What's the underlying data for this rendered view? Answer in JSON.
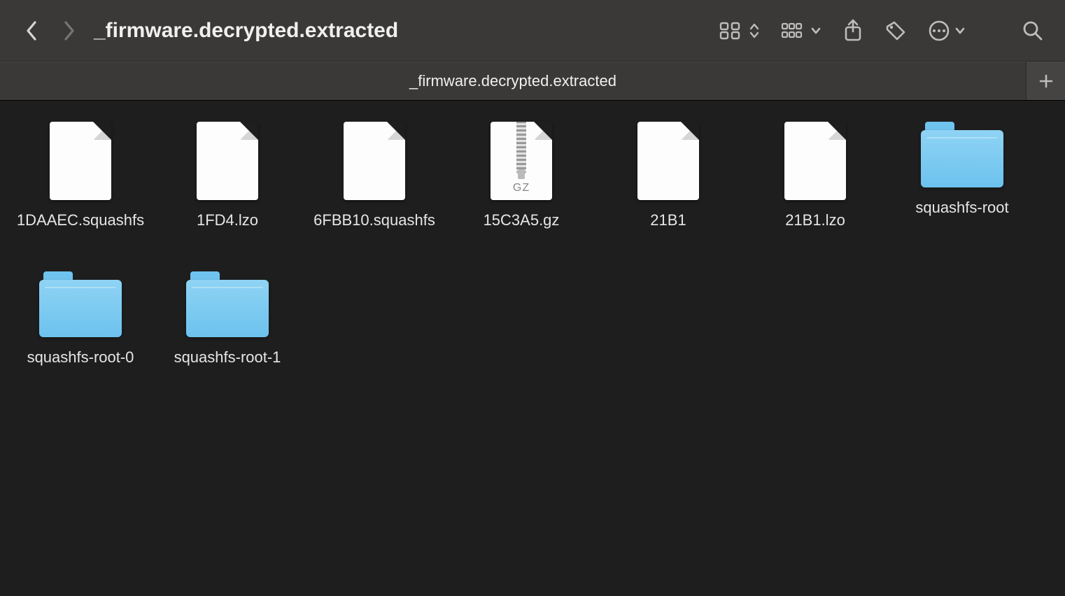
{
  "window": {
    "title": "_firmware.decrypted.extracted",
    "tab_title": "_firmware.decrypted.extracted"
  },
  "items": [
    {
      "name": "1DAAEC.squashfs",
      "kind": "file"
    },
    {
      "name": "1FD4.lzo",
      "kind": "file"
    },
    {
      "name": "6FBB10.squashfs",
      "kind": "file"
    },
    {
      "name": "15C3A5.gz",
      "kind": "gz",
      "badge": "GZ"
    },
    {
      "name": "21B1",
      "kind": "file"
    },
    {
      "name": "21B1.lzo",
      "kind": "file"
    },
    {
      "name": "squashfs-root",
      "kind": "folder"
    },
    {
      "name": "squashfs-root-0",
      "kind": "folder"
    },
    {
      "name": "squashfs-root-1",
      "kind": "folder"
    }
  ]
}
